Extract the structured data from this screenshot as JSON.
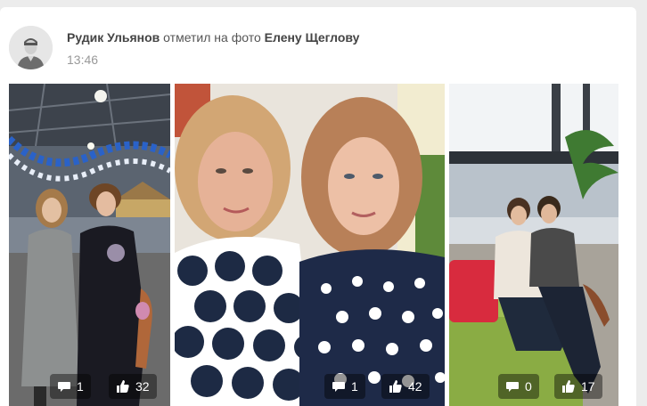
{
  "post": {
    "actor": "Рудик Ульянов",
    "action": "отметил на фото",
    "target": "Елену Щеглову",
    "time": "13:46"
  },
  "photos": [
    {
      "comments": "1",
      "likes": "32"
    },
    {
      "comments": "1",
      "likes": "42"
    },
    {
      "comments": "0",
      "likes": "17"
    }
  ],
  "icons": {
    "avatar": "default-user-icon",
    "comment": "comment-bubble-icon",
    "like": "thumbs-up-icon"
  },
  "colors": {
    "name": "#444444",
    "time": "#999999",
    "stat_bg": "rgba(0,0,0,0.42)"
  }
}
